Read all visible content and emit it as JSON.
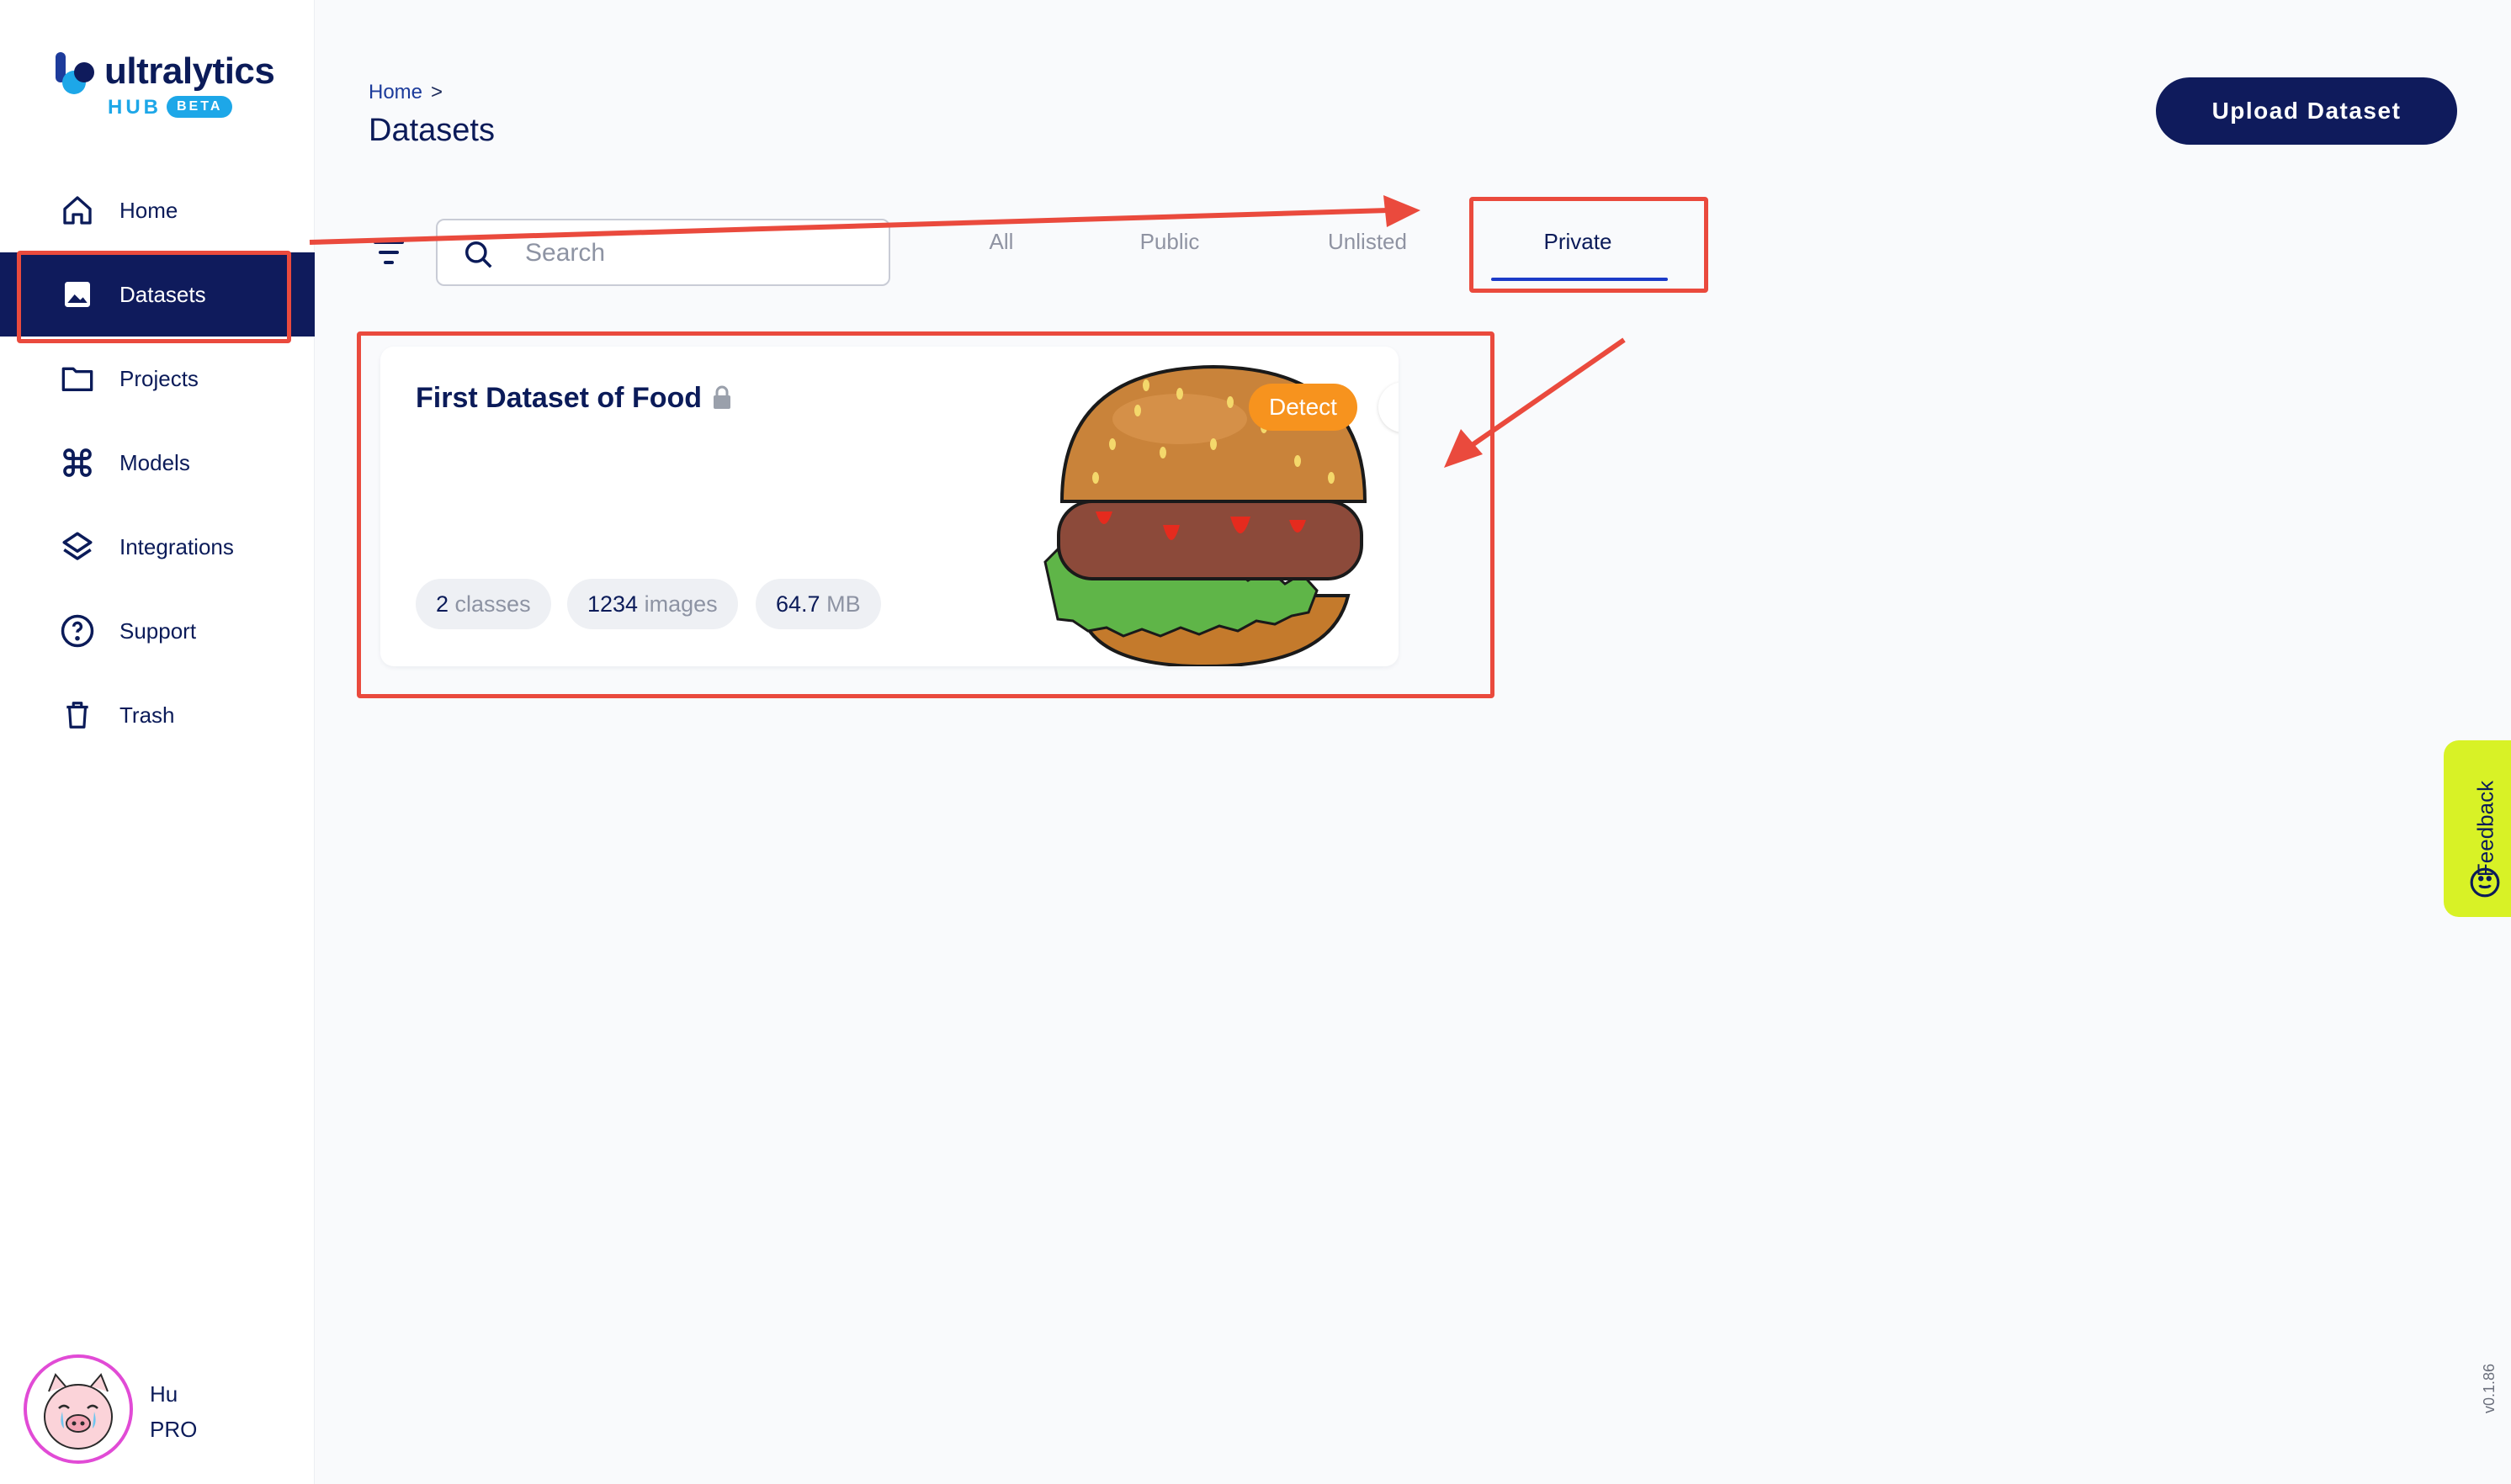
{
  "app": {
    "logo_word": "ultralytics",
    "logo_hub": "HUB",
    "logo_badge": "BETA",
    "version": "v0.1.86"
  },
  "sidebar": {
    "items": [
      {
        "label": "Home",
        "icon": "home-icon"
      },
      {
        "label": "Datasets",
        "icon": "image-icon",
        "active": true
      },
      {
        "label": "Projects",
        "icon": "folder-icon"
      },
      {
        "label": "Models",
        "icon": "command-icon"
      },
      {
        "label": "Integrations",
        "icon": "layers-icon"
      },
      {
        "label": "Support",
        "icon": "help-circle-icon"
      },
      {
        "label": "Trash",
        "icon": "trash-icon"
      }
    ],
    "user": {
      "name": "Hu",
      "plan": "PRO"
    }
  },
  "header": {
    "breadcrumb_home": "Home",
    "breadcrumb_sep": ">",
    "title": "Datasets",
    "upload_label": "Upload Dataset"
  },
  "toolbar": {
    "search_placeholder": "Search",
    "tabs": [
      "All",
      "Public",
      "Unlisted",
      "Private"
    ],
    "active_tab": "Private"
  },
  "datasets": [
    {
      "title": "First Dataset of Food",
      "private": true,
      "task": "Detect",
      "classes_num": "2",
      "classes_unit": "classes",
      "images_num": "1234",
      "images_unit": "images",
      "size_num": "64.7",
      "size_unit": "MB"
    }
  ],
  "feedback": {
    "label": "Feedback"
  },
  "colors": {
    "brand_navy": "#0f1b5c",
    "accent_blue": "#1da7e8",
    "detect_orange": "#f7931e",
    "feedback_yellow": "#d8f226",
    "annotation_red": "#ea4a3d"
  }
}
